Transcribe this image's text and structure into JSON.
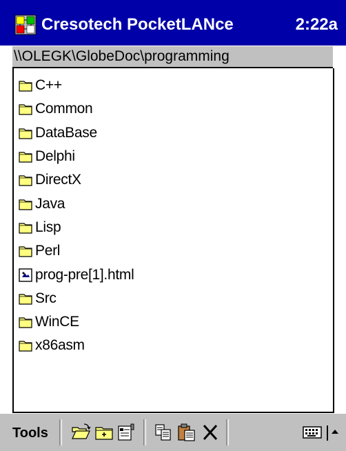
{
  "titlebar": {
    "app_title": "Cresotech PocketLANce",
    "clock": "2:22a"
  },
  "pathbar": {
    "path": "\\\\OLEGK\\GlobeDoc\\programming"
  },
  "files": [
    {
      "name": "C++",
      "icon": "folder-icon"
    },
    {
      "name": "Common",
      "icon": "folder-icon"
    },
    {
      "name": "DataBase",
      "icon": "folder-icon"
    },
    {
      "name": "Delphi",
      "icon": "folder-icon"
    },
    {
      "name": "DirectX",
      "icon": "folder-icon"
    },
    {
      "name": "Java",
      "icon": "folder-icon"
    },
    {
      "name": "Lisp",
      "icon": "folder-icon"
    },
    {
      "name": "Perl",
      "icon": "folder-icon"
    },
    {
      "name": "prog-pre[1].html",
      "icon": "html-file-icon"
    },
    {
      "name": "Src",
      "icon": "folder-icon"
    },
    {
      "name": "WinCE",
      "icon": "folder-icon"
    },
    {
      "name": "x86asm",
      "icon": "folder-icon"
    }
  ],
  "toolbar": {
    "tools_label": "Tools",
    "icons": [
      "open-folder-icon",
      "new-folder-icon",
      "properties-icon",
      "copy-icon",
      "paste-icon",
      "delete-icon",
      "keyboard-icon",
      "input-arrow-icon"
    ]
  },
  "colors": {
    "titlebar": "#0000a8",
    "chrome": "#c0c0c0",
    "folder": "#ffff80"
  }
}
